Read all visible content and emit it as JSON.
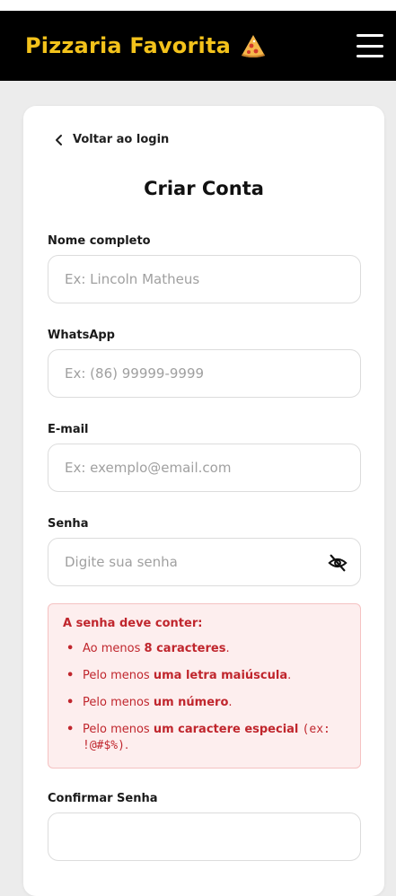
{
  "header": {
    "title": "Pizzaria Favorita",
    "icons": {
      "logo": "pizza-slice-icon",
      "menu": "hamburger-menu-icon"
    },
    "colors": {
      "background": "#000000",
      "title": "#f3c21b"
    }
  },
  "form": {
    "back_label": "Voltar ao login",
    "title": "Criar Conta",
    "fields": {
      "name": {
        "label": "Nome completo",
        "placeholder": "Ex: Lincoln Matheus",
        "value": ""
      },
      "whatsapp": {
        "label": "WhatsApp",
        "placeholder": "Ex: (86) 99999-9999",
        "value": ""
      },
      "email": {
        "label": "E-mail",
        "placeholder": "Ex: exemplo@email.com",
        "value": ""
      },
      "password": {
        "label": "Senha",
        "placeholder": "Digite sua senha",
        "value": "",
        "toggle_icon": "eye-off-icon"
      },
      "confirm": {
        "label": "Confirmar Senha"
      }
    },
    "password_rules": {
      "title": "A senha deve conter:",
      "color": "#c0262d",
      "items": [
        {
          "prefix": "Ao menos ",
          "emphasis": "8 caracteres",
          "suffix": ".",
          "code": "",
          "tail": ""
        },
        {
          "prefix": "Pelo menos ",
          "emphasis": "uma letra maiúscula",
          "suffix": ".",
          "code": "",
          "tail": ""
        },
        {
          "prefix": "Pelo menos ",
          "emphasis": "um número",
          "suffix": ".",
          "code": "",
          "tail": ""
        },
        {
          "prefix": "Pelo menos ",
          "emphasis": "um caractere especial",
          "suffix": " ",
          "code": "(ex: !@#$%)",
          "tail": "."
        }
      ]
    }
  }
}
